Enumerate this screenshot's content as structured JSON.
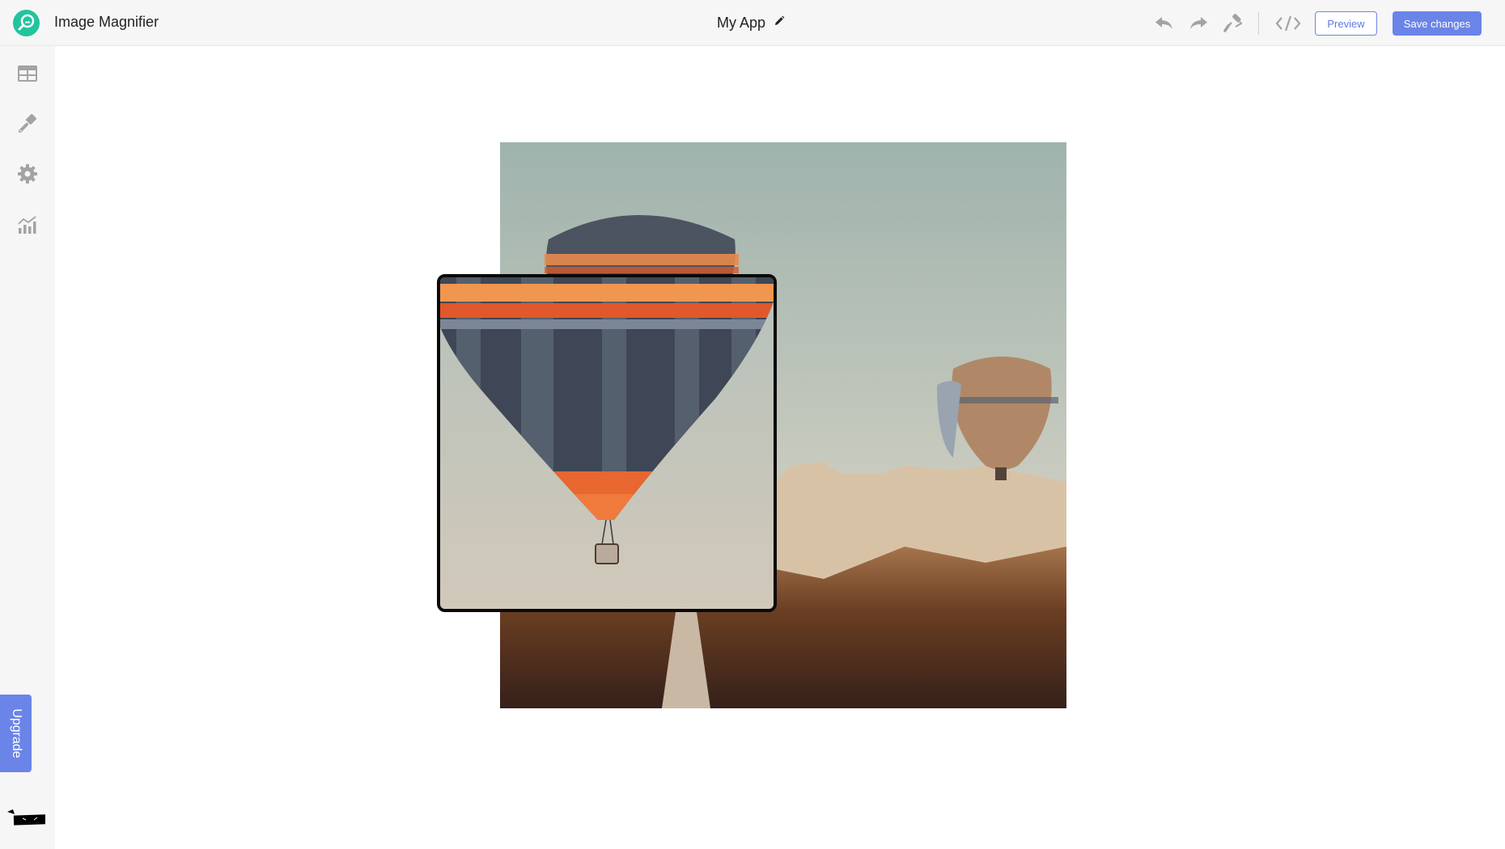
{
  "header": {
    "app_name": "Image Magnifier",
    "project_title": "My App",
    "icons": [
      "undo-icon",
      "redo-icon",
      "paint-roller-icon",
      "code-icon"
    ],
    "preview_label": "Preview",
    "save_label": "Save changes"
  },
  "sidebar": {
    "items": [
      {
        "name": "layout-icon"
      },
      {
        "name": "brush-icon"
      },
      {
        "name": "settings-icon"
      },
      {
        "name": "analytics-icon"
      }
    ],
    "upgrade_label": "Upgrade"
  },
  "canvas": {
    "image_description": "Hot air balloons over Cappadocia landscape",
    "magnifier": "Zoomed lens showing enlarged balloon"
  },
  "colors": {
    "accent": "#6a84e8",
    "logo": "#23c39d",
    "icon_gray": "#a3a3a3"
  }
}
